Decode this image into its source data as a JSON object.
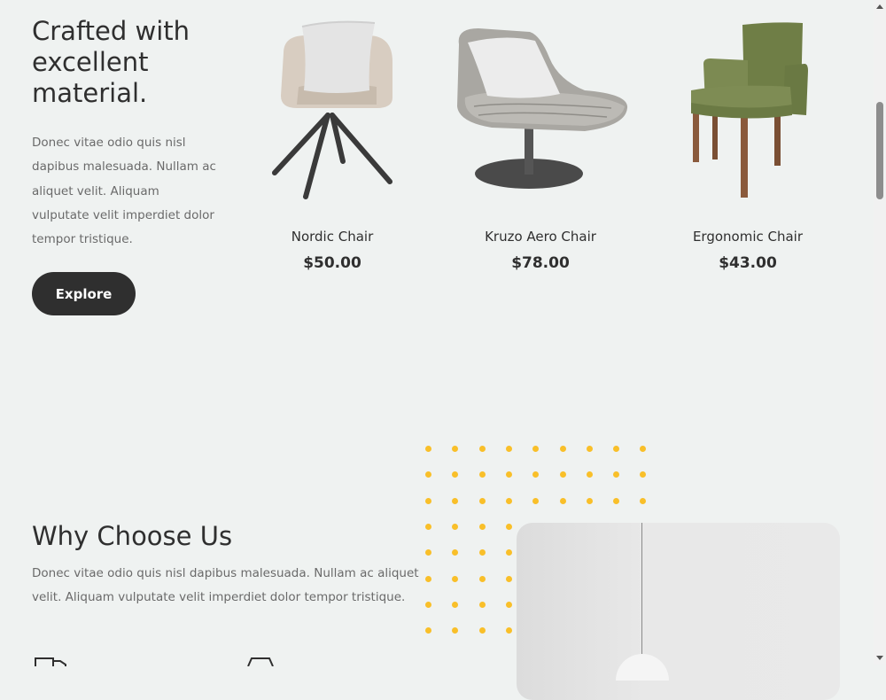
{
  "hero": {
    "title": "Crafted with excellent material.",
    "text": "Donec vitae odio quis nisl dapibus malesuada. Nullam ac aliquet velit. Aliquam vulputate velit imperdiet dolor tempor tristique.",
    "button_label": "Explore"
  },
  "products": [
    {
      "name": "Nordic Chair",
      "price": "$50.00",
      "icon": "nordic-chair-image"
    },
    {
      "name": "Kruzo Aero Chair",
      "price": "$78.00",
      "icon": "kruzo-aero-chair-image"
    },
    {
      "name": "Ergonomic Chair",
      "price": "$43.00",
      "icon": "ergonomic-chair-image"
    }
  ],
  "why": {
    "title": "Why Choose Us",
    "text": "Donec vitae odio quis nisl dapibus malesuada. Nullam ac aliquet velit. Aliquam vulputate velit imperdiet dolor tempor tristique."
  },
  "colors": {
    "background": "#eff2f1",
    "dark": "#2f2f2f",
    "accent_dots": "#f9bf29"
  }
}
